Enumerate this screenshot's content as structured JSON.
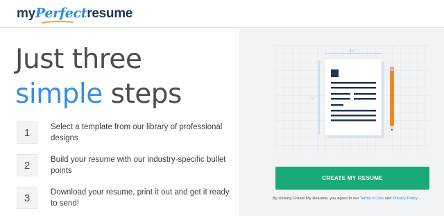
{
  "header": {
    "logo": {
      "part1": "my",
      "part2": "Perfect",
      "part3": "resume"
    }
  },
  "hero": {
    "line1": "Just three",
    "line2_accent": "simple",
    "line2_rest": "steps"
  },
  "steps": [
    {
      "number": "1",
      "text": "Select a template from our library of professional designs"
    },
    {
      "number": "2",
      "text": "Build your resume with our industry-specific bullet points"
    },
    {
      "number": "3",
      "text": "Download your resume, print it out and get it ready to send!"
    }
  ],
  "illustration": {
    "width_label": "8½\"",
    "height_label": "11\""
  },
  "cta": {
    "label": "CREATE MY RESUME"
  },
  "legal": {
    "prefix": "By clicking Create My Resume, you agree to our",
    "terms": "Terms of Use",
    "and": "and",
    "privacy": "Privacy Policy",
    "suffix": "."
  },
  "colors": {
    "accent": "#3a8ee6",
    "cta": "#1aaa7a",
    "navy": "#1e3554",
    "panel": "#f2f3f5"
  }
}
